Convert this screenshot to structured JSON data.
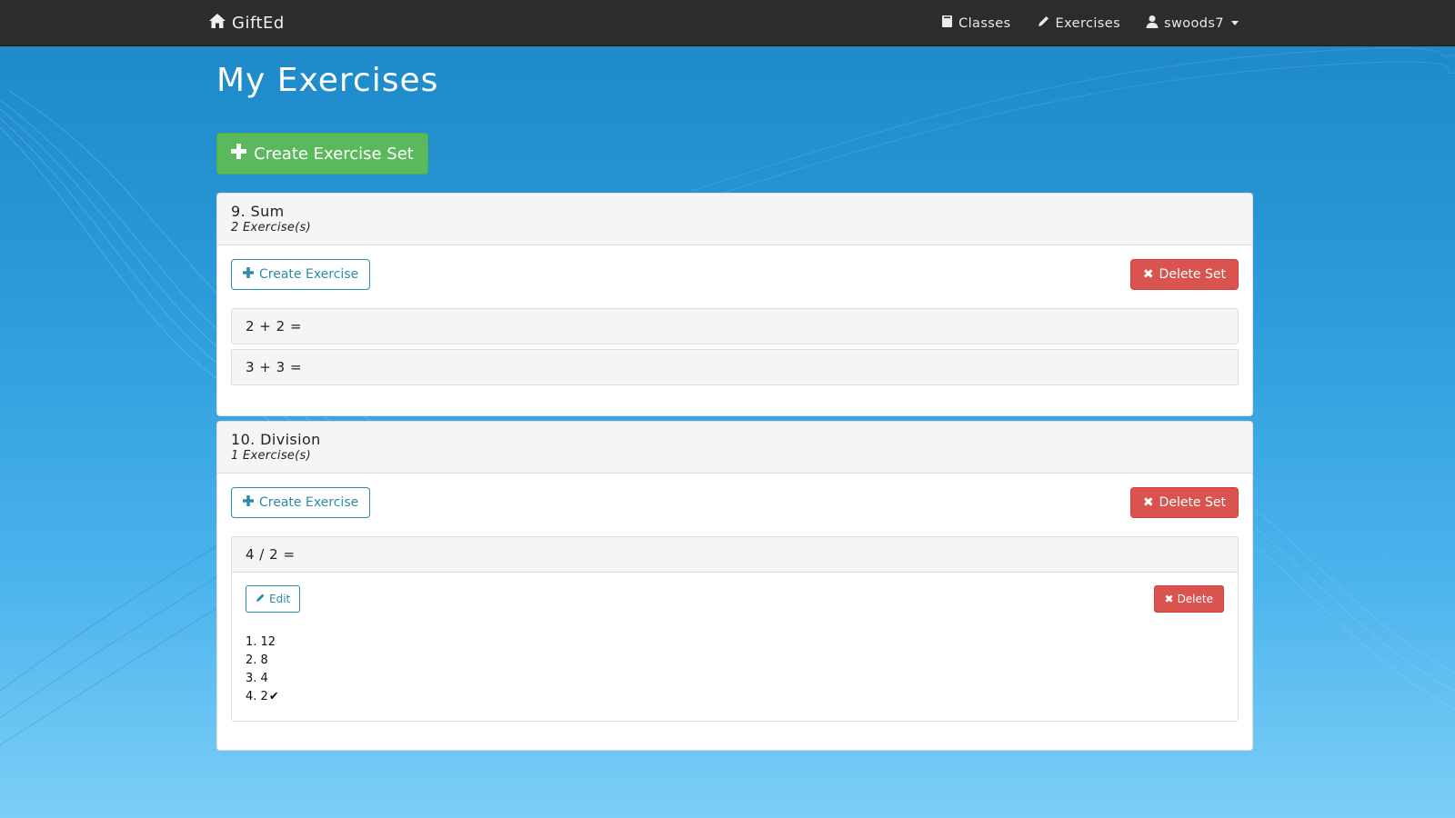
{
  "navbar": {
    "brand": "GiftEd",
    "items": [
      {
        "label": "Classes",
        "icon": "book-icon"
      },
      {
        "label": "Exercises",
        "icon": "pencil-icon"
      },
      {
        "label": "swoods7",
        "icon": "user-icon"
      }
    ]
  },
  "page": {
    "title": "My Exercises",
    "create_set_label": "Create Exercise Set"
  },
  "sets": [
    {
      "title": "9. Sum",
      "count": "2 Exercise(s)",
      "create_label": "Create Exercise",
      "delete_label": "Delete Set",
      "exercises": [
        {
          "question": "2 + 2 ="
        },
        {
          "question": "3 + 3 ="
        }
      ]
    },
    {
      "title": "10. Division",
      "count": "1 Exercise(s)",
      "create_label": "Create Exercise",
      "delete_label": "Delete Set",
      "exercises": [
        {
          "question": "4 / 2 =",
          "edit_label": "Edit",
          "delete_label": "Delete",
          "answers": [
            "1. 12",
            "2. 8",
            "3. 4",
            "4. 2"
          ],
          "correct_mark": "✔"
        }
      ]
    }
  ],
  "colors": {
    "navbar": "#2c2c2c",
    "success": "#5cb85c",
    "danger": "#d9534f",
    "primary_outline": "#2a8ca8"
  }
}
